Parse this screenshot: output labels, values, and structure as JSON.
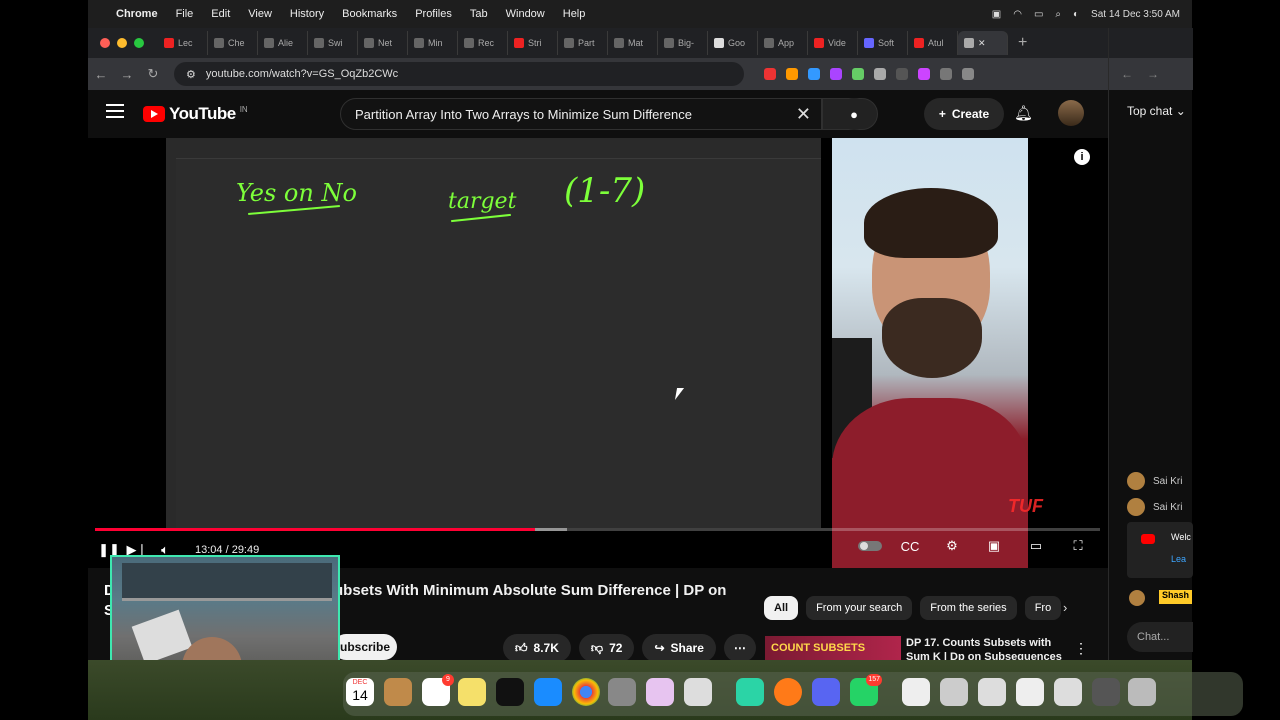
{
  "menubar": {
    "app": "Chrome",
    "items": [
      "File",
      "Edit",
      "View",
      "History",
      "Bookmarks",
      "Profiles",
      "Tab",
      "Window",
      "Help"
    ],
    "datetime": "Sat 14 Dec  3:50 AM"
  },
  "tabs": [
    "Lec",
    "Che",
    "Alie",
    "Swi",
    "Net",
    "Min",
    "Rec",
    "Stri",
    "Part",
    "Mat",
    "Big-",
    "Goo",
    "App",
    "Vide",
    "Soft",
    "Atul"
  ],
  "address": {
    "url": "youtube.com/watch?v=GS_OqZb2CWc"
  },
  "youtube": {
    "logo_text": "YouTube",
    "region": "IN",
    "search_value": "Partition Array Into Two Arrays to Minimize Sum Difference",
    "create_label": "Create"
  },
  "board": {
    "ink1": "Yes on No",
    "ink2": "target",
    "ink3": "(1-7)"
  },
  "player": {
    "time": "13:04 / 29:49",
    "progress_fraction": 0.438,
    "buffered_fraction": 0.47,
    "watermark": "TUF"
  },
  "video": {
    "title": "ubsets With Minimum Absolute Sum Difference | DP on",
    "title_prefix": "D",
    "title_line2": "S",
    "subscribe_label": "ubscribe",
    "likes": "8.7K",
    "dislikes": "72",
    "share_label": "Share"
  },
  "chips": [
    "All",
    "From your search",
    "From the series",
    "Fro"
  ],
  "recommendation": {
    "thumb_text": "COUNT SUBSETS",
    "title": "DP 17. Counts Subsets with Sum K | Dp on Subsequences"
  },
  "chat": {
    "top_label": "Top chat",
    "messages": [
      {
        "name": "Sai Kri"
      },
      {
        "name": "Sai Kri"
      }
    ],
    "welcome_text": "Welc",
    "welcome_link": "Lea",
    "highlight_name": "Shash",
    "input_placeholder": "Chat..."
  },
  "dock": {
    "calendar_month": "DEC",
    "calendar_day": "14",
    "reminders_badge": "9",
    "whatsapp_badge": "157"
  },
  "colors": {
    "yt_red": "#ff0000",
    "progress": "#ff0033",
    "ink": "#7dff3a",
    "pip_border": "#3ee8b0"
  }
}
